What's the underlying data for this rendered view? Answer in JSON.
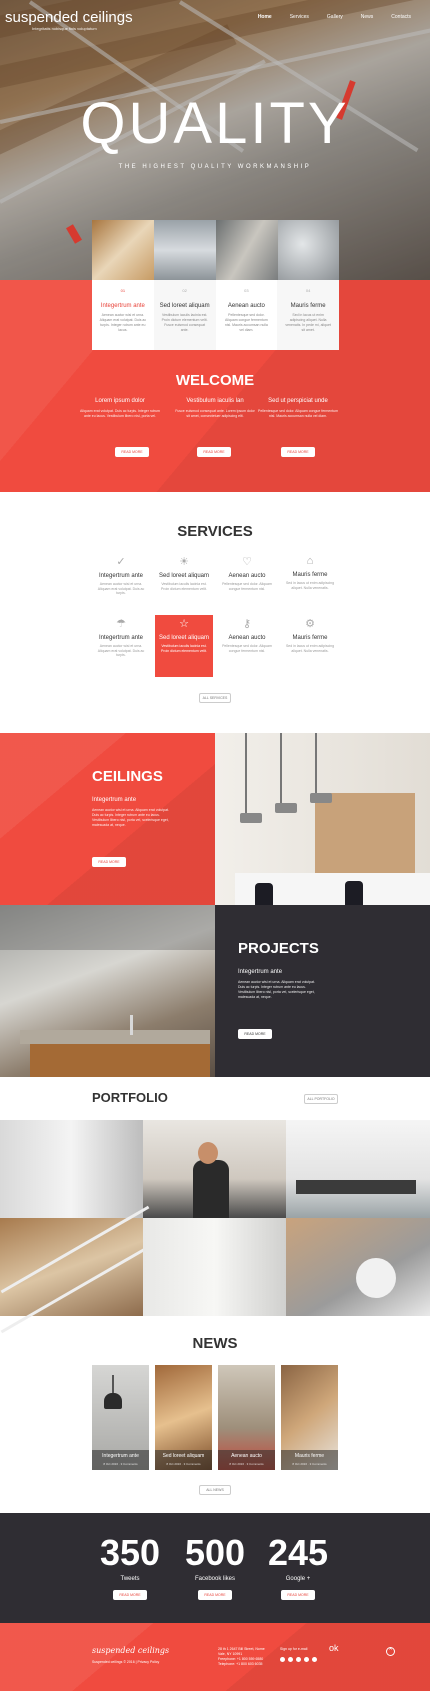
{
  "header": {
    "logo": "suspended ceilings",
    "tagline": "Integritatis nobisque finis voluptatum",
    "nav": [
      "Home",
      "Services",
      "Gallery",
      "News",
      "Contacts"
    ]
  },
  "hero": {
    "title": "QUALITY",
    "subtitle": "THE HIGHEST QUALITY WORKMANSHIP"
  },
  "features": [
    {
      "num": "01",
      "title": "Integertrum ante",
      "text": "Aenean auctor wisi et urna. Aliquam erat volutpat. Duis ac turpis. Integer rutrum ante eu lacus."
    },
    {
      "num": "02",
      "title": "Sed loreet aliquam",
      "text": "Vestibulum iaculis lacinia est. Proin dictum elementum velit. Fusce euismod consequat ante."
    },
    {
      "num": "03",
      "title": "Aenean aucto",
      "text": "Pellentesque sed dolor. Aliquam congue fermentum nisl. Mauris accumsan nulla vel diam."
    },
    {
      "num": "04",
      "title": "Mauris ferme",
      "text": "Sed in lacus ut enim adipiscing aliquet. Nulla venenatis. In pede mi, aliquet sit amet."
    }
  ],
  "welcome": {
    "heading": "WELCOME",
    "columns": [
      {
        "title": "Lorem ipsum dolor",
        "text": "Aliquam erat volutpat. Duis ac turpis. Integer rutrum ante eu lacus. Vestibulum libero nisl, porta vel.",
        "button": "READ MORE"
      },
      {
        "title": "Vestibulum iaculis lan",
        "text": "Fusce euismod consequat ante. Lorem ipsum dolor sit amet, consectetuer adipiscing elit.",
        "button": "READ MORE"
      },
      {
        "title": "Sed ut perspiciat unde",
        "text": "Pellentesque sed dolor. Aliquam congue fermentum nisl. Mauris accumsan nulla vel diam.",
        "button": "READ MORE"
      }
    ]
  },
  "services": {
    "heading": "SERVICES",
    "items": [
      {
        "icon": "check-circle-icon",
        "glyph": "✓",
        "title": "Integertrum ante",
        "text": "Aenean auctor wisi et urna. Aliquam erat volutpat. Duis ac turpis."
      },
      {
        "icon": "sun-icon",
        "glyph": "☀",
        "title": "Sed loreet aliquam",
        "text": "Vestibulum iaculis lacinia est. Proin dictum elementum velit."
      },
      {
        "icon": "heart-icon",
        "glyph": "♡",
        "title": "Aenean aucto",
        "text": "Pellentesque sed dolor. Aliquam congue fermentum nisl."
      },
      {
        "icon": "gift-icon",
        "glyph": "⌂",
        "title": "Mauris ferme",
        "text": "Sed in lacus ut enim adipiscing aliquet. Nulla venenatis."
      },
      {
        "icon": "lamp-icon",
        "glyph": "☂",
        "title": "Integertrum ante",
        "text": "Aenean auctor wisi et urna. Aliquam erat volutpat. Duis ac turpis."
      },
      {
        "icon": "star-icon",
        "glyph": "☆",
        "title": "Sed loreet aliquam",
        "text": "Vestibulum iaculis lacinia est. Proin dictum elementum velit."
      },
      {
        "icon": "key-icon",
        "glyph": "⚷",
        "title": "Aenean aucto",
        "text": "Pellentesque sed dolor. Aliquam congue fermentum nisl."
      },
      {
        "icon": "gear-icon",
        "glyph": "⚙",
        "title": "Mauris ferme",
        "text": "Sed in lacus ut enim adipiscing aliquet. Nulla venenatis."
      }
    ],
    "all_button": "ALL SERVICES"
  },
  "ceilings": {
    "heading": "CEILINGS",
    "subtitle": "Integertrum ante",
    "text": "Aenean auctor wisi et urna. Aliquam erat volutpat. Duis ac turpis. Integer rutrum ante eu lacus. Vestibulum libero nisl, porta vel, scelerisque eget, malesuada at, neque.",
    "button": "READ MORE"
  },
  "projects": {
    "heading": "PROJECTS",
    "subtitle": "Integertrum ante",
    "text": "Aenean auctor wisi et urna. Aliquam erat volutpat. Duis ac turpis. Integer rutrum ante eu lacus. Vestibulum libero nisl, porta vel, scelerisque eget, malesuada at, neque.",
    "button": "READ MORE"
  },
  "portfolio": {
    "heading": "PORTFOLIO",
    "button": "ALL PORTFOLIO"
  },
  "news": {
    "heading": "NEWS",
    "items": [
      {
        "title": "Integertrum ante",
        "date": "8 Oct 2016",
        "comments": "3 Comments"
      },
      {
        "title": "Sed loreet aliquam",
        "date": "8 Oct 2016",
        "comments": "3 Comments"
      },
      {
        "title": "Aenean aucto",
        "date": "8 Oct 2016",
        "comments": "3 Comments"
      },
      {
        "title": "Mauris ferme",
        "date": "8 Oct 2016",
        "comments": "3 Comments"
      }
    ],
    "all_button": "ALL NEWS"
  },
  "counters": [
    {
      "value": "350",
      "label": "Tweets",
      "button": "READ MORE"
    },
    {
      "value": "500",
      "label": "Facebook likes",
      "button": "READ MORE"
    },
    {
      "value": "245",
      "label": "Google +",
      "button": "READ MORE"
    }
  ],
  "footer": {
    "logo": "suspended ceilings",
    "copyright": "Suspended ceilings © 2016 | Privacy Policy",
    "address": "28 th 1 2647 Bill Street, Nome Vale, NY 10991",
    "phone": "Freephone: +1 800 559 6580",
    "tel": "Telephone: +1 800 603 6035",
    "signup": "Sign up for e-mail",
    "ok": "ok"
  },
  "colors": {
    "accent": "#f04b3f",
    "dark": "#2f2d33"
  }
}
